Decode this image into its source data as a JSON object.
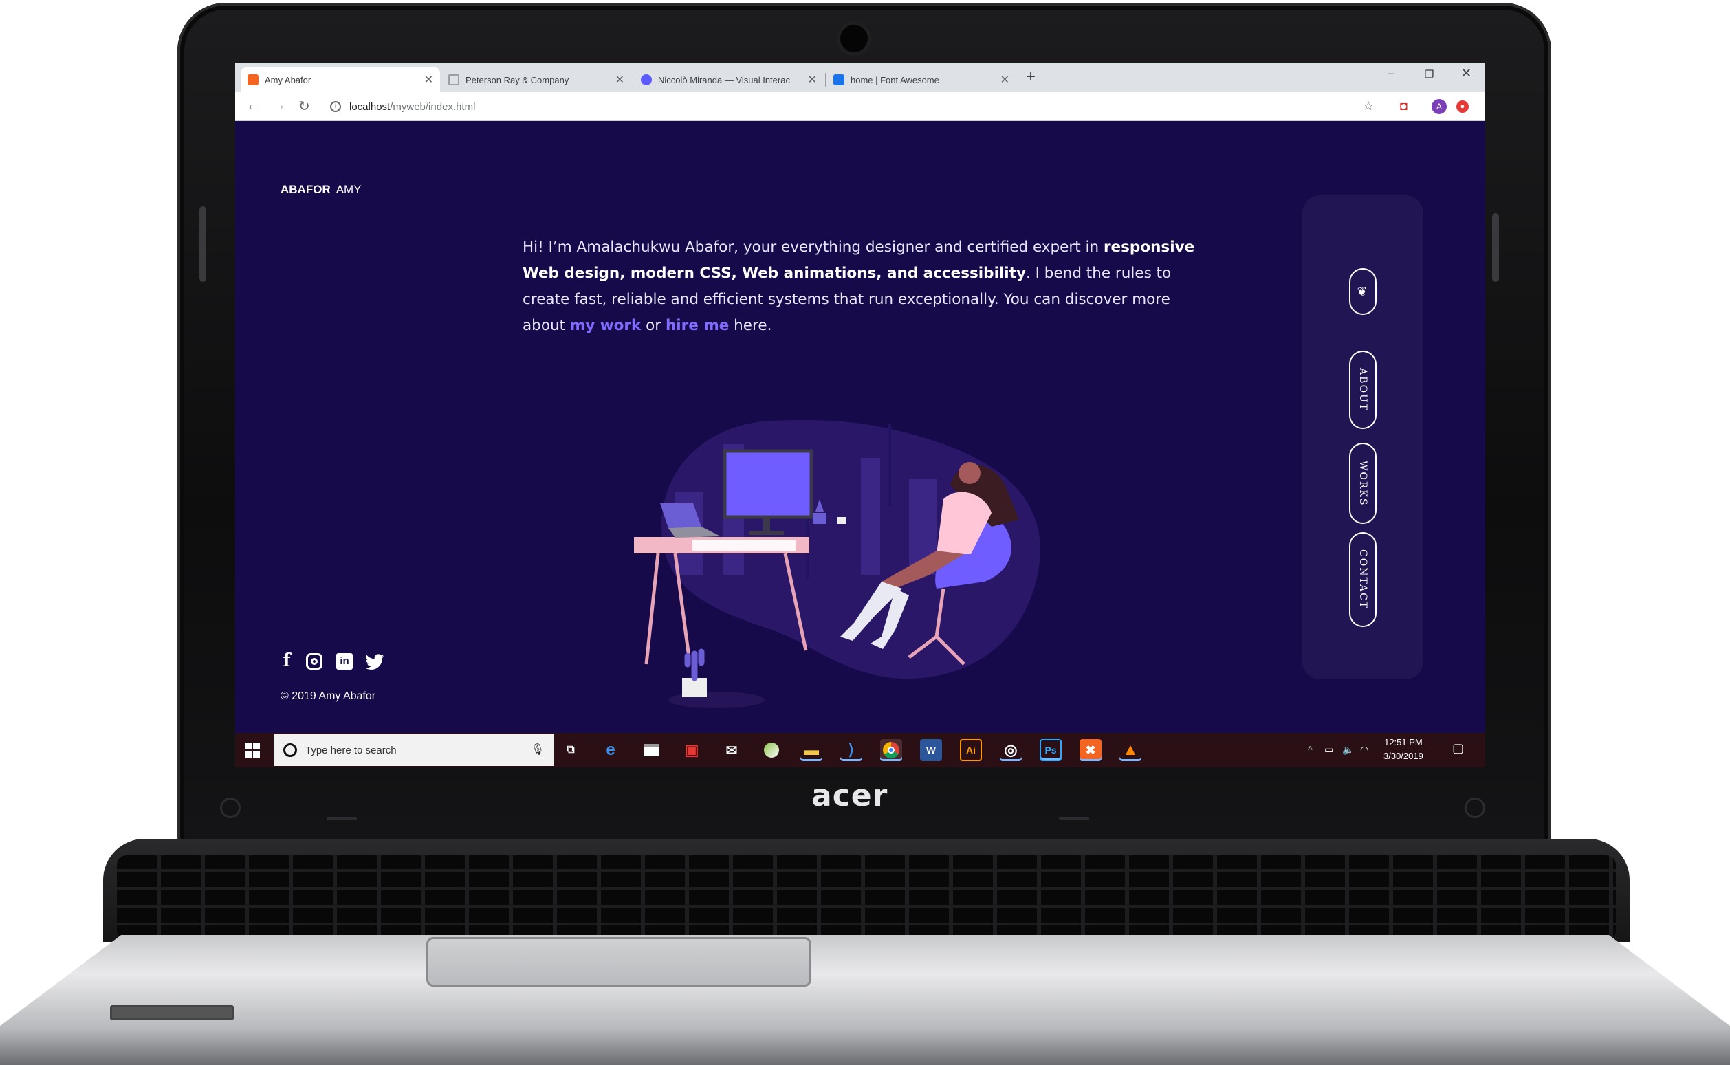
{
  "device": {
    "brand_logo": "acer"
  },
  "browser": {
    "tabs": [
      {
        "title": "Amy Abafor",
        "favicon_color": "#f26522",
        "active": true
      },
      {
        "title": "Peterson Ray & Company",
        "favicon_color": "#9aa0a6",
        "active": false
      },
      {
        "title": "Niccolò Miranda — Visual Interac",
        "favicon_color": "#5b5bff",
        "active": false
      },
      {
        "title": "home | Font Awesome",
        "favicon_color": "#1a73e8",
        "active": false
      }
    ],
    "address": {
      "host": "localhost",
      "path": "/myweb/index.html"
    },
    "profile_initial": "A"
  },
  "site": {
    "brand_first": "ABAFOR",
    "brand_second": "AMY",
    "intro": {
      "p1": "Hi! I’m Amalachukwu Abafor, your everything designer and certified expert in ",
      "bold": "responsive Web design, modern CSS, Web animations, and accessibility",
      "p2": ". I bend the rules to create fast, reliable and efficient systems that run exceptionally. You can discover more about ",
      "link1": "my work",
      "p3": " or ",
      "link2": "hire me",
      "p4": " here."
    },
    "nav": {
      "home_icon": "bird-icon",
      "items": [
        "ABOUT",
        "WORKS",
        "CONTACT"
      ]
    },
    "social": [
      "facebook-icon",
      "instagram-icon",
      "linkedin-icon",
      "twitter-icon"
    ],
    "copyright": "© 2019 Amy Abafor",
    "colors": {
      "background": "#160a4a",
      "accent": "#7f6cff",
      "panel": "#221553"
    }
  },
  "taskbar": {
    "search_placeholder": "Type here to search",
    "time": "12:51 PM",
    "date": "3/30/2019",
    "apps": [
      "task-view-icon",
      "edge-icon",
      "store-icon",
      "gift-icon",
      "mail-icon",
      "sketch-icon",
      "file-explorer-icon",
      "vscode-icon",
      "chrome-icon",
      "word-icon",
      "illustrator-icon",
      "media-player-icon",
      "photoshop-icon",
      "xampp-icon",
      "vlc-icon"
    ]
  }
}
